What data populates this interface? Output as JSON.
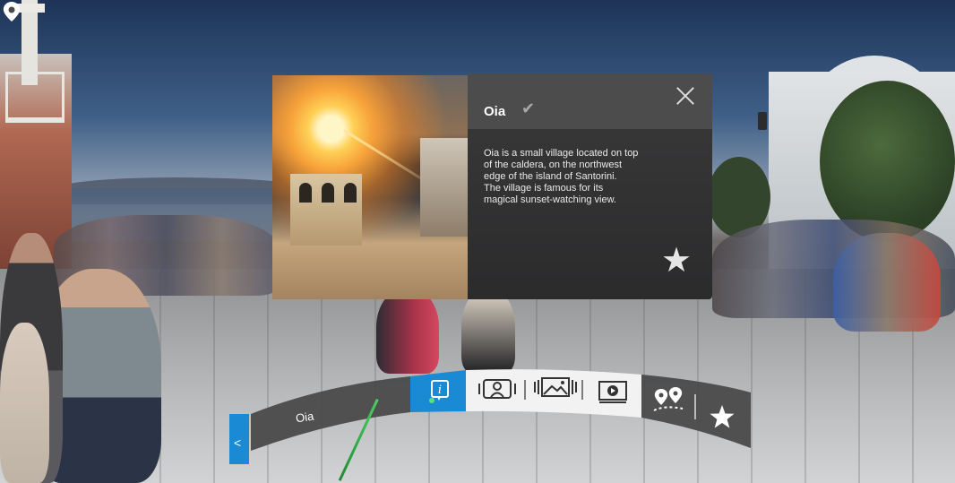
{
  "info_card": {
    "title": "Oia",
    "description": "Oia is a small village located on top\nof the caldera, on the northwest\nedge of the island of Santorini.\nThe village is famous for its\nmagical sunset-watching view.",
    "icons": {
      "check": "checkmark-icon",
      "close": "close-icon",
      "favorite": "star-icon"
    }
  },
  "nav_bar": {
    "location_label": "Oia",
    "back_icon": "chevron-left-icon",
    "location_icon": "map-pin-icon",
    "tabs": [
      {
        "name": "info",
        "icon": "info-icon",
        "active": true
      },
      {
        "name": "panorama-person",
        "icon": "panorama-person-icon",
        "active": false
      },
      {
        "name": "photo-gallery",
        "icon": "photo-gallery-icon",
        "active": false
      },
      {
        "name": "video",
        "icon": "video-icon",
        "active": false
      },
      {
        "name": "nearby-places",
        "icon": "nearby-places-icon",
        "active": false
      },
      {
        "name": "favorites",
        "icon": "star-icon",
        "active": false
      }
    ]
  },
  "colors": {
    "accent": "#1a8ad4",
    "bar_dark": "#4a4a4b",
    "bar_light": "#f2f2f2",
    "laser": "#3fc255"
  }
}
